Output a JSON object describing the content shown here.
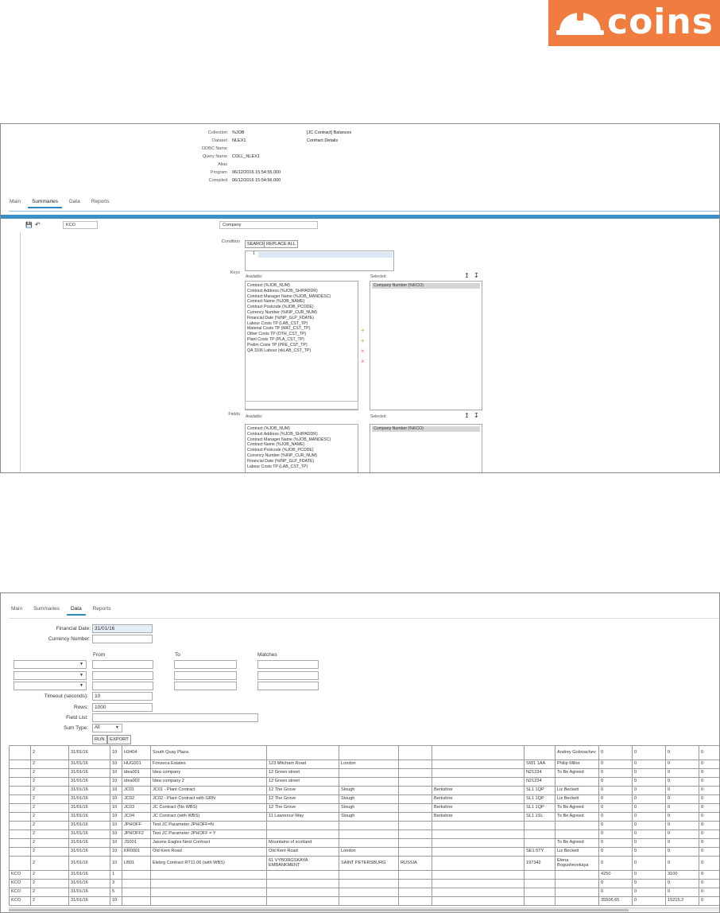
{
  "logo": {
    "text": "coins",
    "color": "#f07c3f"
  },
  "top": {
    "meta": [
      {
        "label": "Collection",
        "value": "%JOB",
        "desc": "[JC Contract] Balances"
      },
      {
        "label": "Dataset",
        "value": "NLEX1",
        "desc": "Contract Details"
      },
      {
        "label": "ODBC Name",
        "value": "",
        "desc": ""
      },
      {
        "label": "Query Name",
        "value": "COLL_NLEX1",
        "desc": ""
      },
      {
        "label": "Alias",
        "value": "",
        "desc": ""
      },
      {
        "label": "Program",
        "value": "06/12/2016 15:54:55.000",
        "desc": ""
      },
      {
        "label": "Compiled",
        "value": "06/12/2016 15:54:56.000",
        "desc": ""
      }
    ],
    "tabs": [
      "Main",
      "Summaries",
      "Data",
      "Reports"
    ],
    "active_tab": "Summaries",
    "row_code": "KCO",
    "row_name": "Company",
    "condition_label": "Condition",
    "search_btn": "SEARCH",
    "replace_btn": "REPLACE ALL",
    "code_line": "1",
    "keys_label": "Keys",
    "fields_label": "Fields",
    "available_label": "Available:",
    "selected_label": "Selected:",
    "keys_available": [
      "Contract (%JOB_NUM)",
      "Contract Address (%JOB_SHIPADDR)",
      "Contract Manager Name (%JOB_MANDESC)",
      "Contract Name (%JOB_NAME)",
      "Contract Postcode (%JOB_PCODE)",
      "Currency Number (%INP_CUR_NUM)",
      "Financial Date (%INP_GLP_FDATE)",
      "Labour Costs TP (LAB_CST_TP)",
      "Material Costs TP (MAT_CST_TP)",
      "Other Costs TP (OTH_CST_TP)",
      "Plant Costs TP (PLA_CST_TP)",
      "Prelim Costs TP (PRE_CST_TP)",
      "QA 1106 Labour (xkLAB_CST_TP)"
    ],
    "keys_selected": "Company Number (%KCO)",
    "fields_available": [
      "Contract (%JOB_NUM)",
      "Contract Address (%JOB_SHIPADDR)",
      "Contract Manager Name (%JOB_MANDESC)",
      "Contract Name (%JOB_NAME)",
      "Contract Postcode (%JOB_PCODE)",
      "Currency Number (%INP_CUR_NUM)",
      "Financial Date (%INP_GLP_FDATE)",
      "Labour Costs TP (LAB_CST_TP)"
    ],
    "fields_selected": "Company Number (%KCO)"
  },
  "bottom": {
    "tabs": [
      "Main",
      "Summaries",
      "Data",
      "Reports"
    ],
    "active_tab": "Data",
    "financial_date_label": "Financial Date:",
    "financial_date": "31/01/16",
    "currency_label": "Currency Number:",
    "currency": "",
    "from_label": "From",
    "to_label": "To",
    "matches_label": "Matches",
    "timeout_label": "Timeout (seconds):",
    "timeout": "10",
    "rows_label": "Rows:",
    "rows": "1000",
    "fieldlist_label": "Field List:",
    "fieldlist": "",
    "sumtype_label": "Sum Type:",
    "sumtype": "All",
    "run_btn": "RUN",
    "export_btn": "EXPORT",
    "rows_data": [
      [
        "",
        "2",
        "31/01/16",
        "10",
        "H3404",
        "South Quay Plaza",
        "",
        "",
        "",
        "",
        "",
        "Andrey Golovachev",
        "0",
        "0",
        "0",
        "0",
        "0"
      ],
      [
        "",
        "2",
        "31/01/16",
        "10",
        "HUG001",
        "Fonseca Estates",
        "123 Mitcham Road",
        "London",
        "",
        "",
        "SW1 1AA",
        "Philip Millor",
        "0",
        "0",
        "0",
        "0",
        "0"
      ],
      [
        "",
        "2",
        "31/01/16",
        "10",
        "idea001",
        "Idea company",
        "12 Green street",
        "",
        "",
        "",
        "N21234",
        "To Be Agreed",
        "0",
        "0",
        "0",
        "0",
        "0"
      ],
      [
        "",
        "2",
        "31/01/16",
        "10",
        "idea002",
        "Idea company 2",
        "12 Green street",
        "",
        "",
        "",
        "N21234",
        "",
        "0",
        "0",
        "0",
        "0",
        "0"
      ],
      [
        "",
        "2",
        "31/01/16",
        "10",
        "JC01",
        "JC01 - Plant Contract",
        "12 The Grove",
        "Slough",
        "",
        "Berkshire",
        "SL1 1QP",
        "Liz Beckett",
        "0",
        "0",
        "0",
        "0",
        "0"
      ],
      [
        "",
        "2",
        "31/01/16",
        "10",
        "JC02",
        "JC02 - Plant Contract with GRN",
        "12 The Grove",
        "Slough",
        "",
        "Berkshire",
        "SL1 1QP",
        "Liz Beckett",
        "0",
        "0",
        "0",
        "0",
        "0"
      ],
      [
        "",
        "2",
        "31/01/16",
        "10",
        "JC03",
        "JC Contract (No WBS)",
        "12 The Grove",
        "Slough",
        "",
        "Berkshire",
        "SL1 1QP",
        "To Be Agreed",
        "0",
        "0",
        "0",
        "0",
        "0"
      ],
      [
        "",
        "2",
        "31/01/16",
        "10",
        "JC04",
        "JC Contract (with WBS)",
        "11 Lawrence Way",
        "Slough",
        "",
        "Berkshire",
        "SL1 1SL",
        "To Be Agreed",
        "0",
        "0",
        "0",
        "0",
        "0"
      ],
      [
        "",
        "2",
        "31/01/16",
        "10",
        "JPHOFF",
        "Test JC Parameter JPHOFF=N",
        "",
        "",
        "",
        "",
        "",
        "",
        "0",
        "0",
        "0",
        "0",
        "0"
      ],
      [
        "",
        "2",
        "31/01/16",
        "10",
        "JPHOFF2",
        "Test JC Parameter JPHOFF = Y",
        "",
        "",
        "",
        "",
        "",
        "",
        "0",
        "0",
        "0",
        "0",
        "0"
      ],
      [
        "",
        "2",
        "31/01/16",
        "10",
        "JS001",
        "Jasons Eagles Nest Contract",
        "Mountains of scotland",
        "",
        "",
        "",
        "",
        "To Be Agreed",
        "0",
        "0",
        "0",
        "0",
        "0"
      ],
      [
        "",
        "2",
        "31/01/16",
        "10",
        "KR0001",
        "Old Kent Road",
        "Old Kent Road",
        "London",
        "",
        "",
        "SE1 5TY",
        "Liz Beckett",
        "0",
        "0",
        "0",
        "0",
        "0"
      ],
      [
        "",
        "2",
        "31/01/16",
        "10",
        "LB01",
        "Elebrg Contract RT11.06 (with WBS)",
        "61 VYBORGSKAYA EMBANKMENT",
        "SAINT PETERSBURG",
        "RUSSIA",
        "",
        "197342",
        "Elena Bogushevskaya",
        "0",
        "0",
        "0",
        "0",
        "0"
      ],
      [
        "KCO",
        "2",
        "31/01/16",
        "1",
        "",
        "",
        "",
        "",
        "",
        "",
        "",
        "",
        "4250",
        "0",
        "3100",
        "0",
        "0"
      ],
      [
        "KCO",
        "2",
        "31/01/16",
        "3",
        "",
        "",
        "",
        "",
        "",
        "",
        "",
        "",
        "0",
        "0",
        "0",
        "0",
        "0"
      ],
      [
        "KCO",
        "2",
        "31/01/16",
        "5",
        "",
        "",
        "",
        "",
        "",
        "",
        "",
        "",
        "0",
        "0",
        "0",
        "0",
        "0"
      ],
      [
        "KCO",
        "2",
        "31/01/16",
        "10",
        "",
        "",
        "",
        "",
        "",
        "",
        "",
        "",
        "35506.65",
        "0",
        "15215.2",
        "0",
        "0"
      ]
    ]
  }
}
